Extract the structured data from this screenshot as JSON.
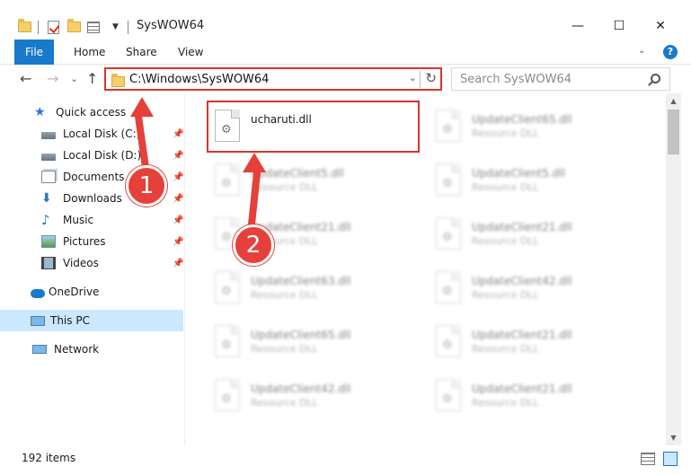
{
  "window": {
    "title": "SysWOW64",
    "minimize": "—",
    "maximize": "☐",
    "close": "✕"
  },
  "ribbon": {
    "tabs": [
      "File",
      "Home",
      "Share",
      "View"
    ],
    "expand_glyph": "⌄",
    "help_glyph": "?"
  },
  "nav": {
    "back": "←",
    "forward": "→",
    "recent": "⌄",
    "up": "↑",
    "address": "C:\\Windows\\SysWOW64",
    "dropdown": "⌄",
    "refresh": "↻",
    "search_placeholder": "Search SysWOW64"
  },
  "sidebar": {
    "pin_glyph": "📌",
    "items": [
      {
        "label": "Quick access",
        "icon": "star-icon"
      },
      {
        "label": "Local Disk (C:)",
        "icon": "drive-icon",
        "pinned": true
      },
      {
        "label": "Local Disk (D:)",
        "icon": "drive-icon",
        "pinned": true
      },
      {
        "label": "Documents",
        "icon": "documents-icon",
        "pinned": true
      },
      {
        "label": "Downloads",
        "icon": "downloads-icon",
        "pinned": true
      },
      {
        "label": "Music",
        "icon": "music-icon",
        "pinned": true
      },
      {
        "label": "Pictures",
        "icon": "pictures-icon",
        "pinned": true
      },
      {
        "label": "Videos",
        "icon": "videos-icon",
        "pinned": true
      },
      {
        "label": "OneDrive",
        "icon": "onedrive-icon"
      },
      {
        "label": "This PC",
        "icon": "pc-icon",
        "selected": true
      },
      {
        "label": "Network",
        "icon": "network-icon"
      }
    ]
  },
  "files": [
    {
      "name": "ucharuti.dll",
      "type": "",
      "clear": true
    },
    {
      "name": "UpdateClient65.dll",
      "type": "Resource DLL"
    },
    {
      "name": "UpdateClient5.dll",
      "type": "Resource DLL"
    },
    {
      "name": "UpdateClient5.dll",
      "type": "Resource DLL"
    },
    {
      "name": "UpdateClient21.dll",
      "type": "Resource DLL"
    },
    {
      "name": "UpdateClient21.dll",
      "type": "Resource DLL"
    },
    {
      "name": "UpdateClient63.dll",
      "type": "Resource DLL"
    },
    {
      "name": "UpdateClient42.dll",
      "type": "Resource DLL"
    },
    {
      "name": "UpdateClient65.dll",
      "type": "Resource DLL"
    },
    {
      "name": "UpdateClient21.dll",
      "type": "Resource DLL"
    },
    {
      "name": "UpdateClient42.dll",
      "type": "Resource DLL"
    },
    {
      "name": "UpdateClient21.dll",
      "type": "Resource DLL"
    }
  ],
  "status": {
    "count": "192 items"
  },
  "callouts": {
    "one": "1",
    "two": "2",
    "color": "#e5403a"
  },
  "colors": {
    "accent": "#1979ca",
    "highlight": "#d9342b",
    "selection": "#cce8ff"
  }
}
